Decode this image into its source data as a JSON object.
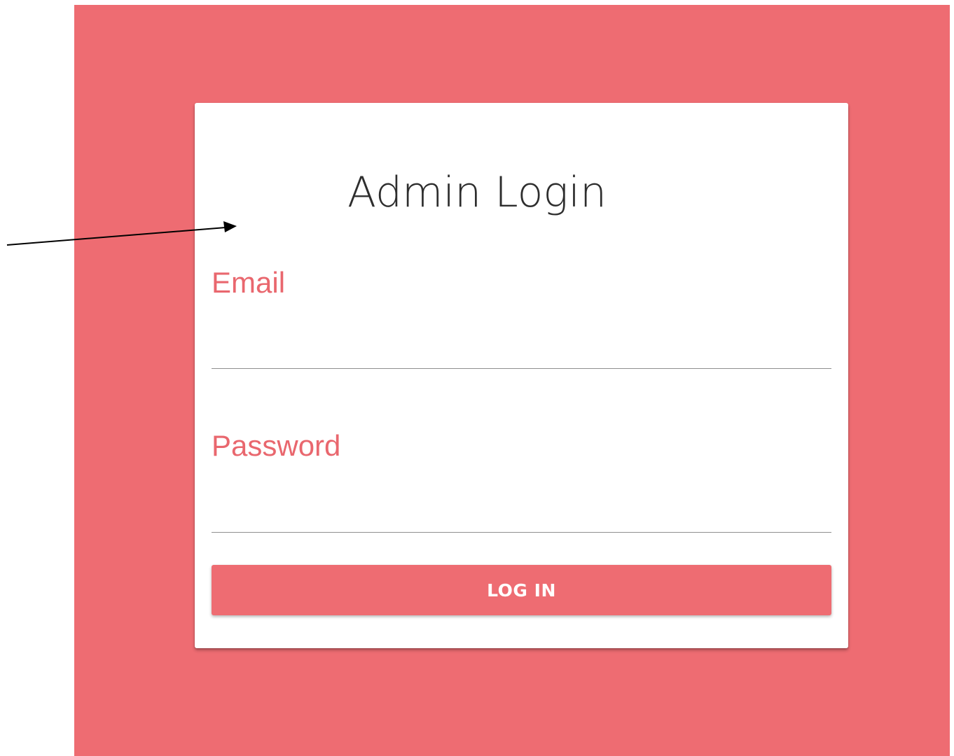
{
  "login_form": {
    "title": "Admin Login",
    "email_label": "Email",
    "email_value": "",
    "password_label": "Password",
    "password_value": "",
    "submit_label": "LOG IN"
  },
  "colors": {
    "accent": "#ee6c72",
    "label": "#e9676e",
    "title_text": "#2e2e2e",
    "card": "#ffffff"
  },
  "annotation": {
    "icon": "arrow-icon"
  }
}
